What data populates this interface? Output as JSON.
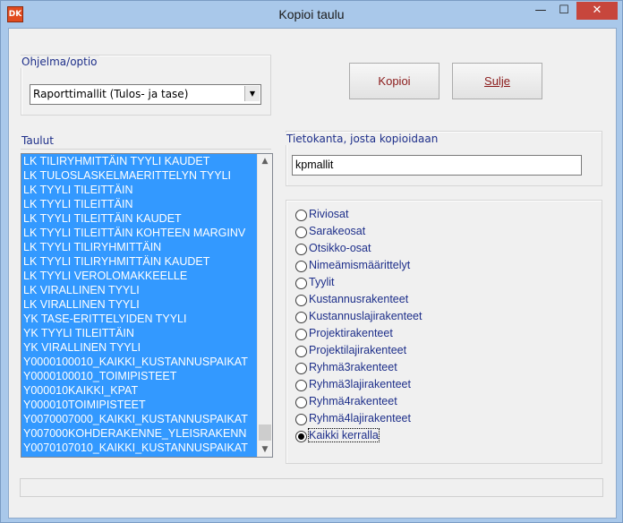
{
  "window": {
    "title": "Kopioi taulu",
    "icon_text": "DK",
    "minimize_glyph": "—",
    "maximize_glyph": "☐",
    "close_glyph": "✕"
  },
  "program_group": {
    "label": "Ohjelma/optio",
    "selected": "Raporttimallit (Tulos- ja tase)",
    "dropdown_glyph": "▼"
  },
  "buttons": {
    "copy": "Kopioi",
    "close": "Sulje"
  },
  "tables_group": {
    "label": "Taulut",
    "items": [
      "LK TILIRYHMITTÄIN TYYLI KAUDET",
      "LK TULOSLASKELMAERITTELYN TYYLI",
      "LK TYYLI TILEITTÄIN",
      "LK TYYLI TILEITTÄIN",
      "LK TYYLI TILEITTÄIN KAUDET",
      "LK TYYLI TILEITTÄIN KOHTEEN MARGINV",
      "LK TYYLI TILIRYHMITTÄIN",
      "LK TYYLI TILIRYHMITTÄIN KAUDET",
      "LK TYYLI VEROLOMAKKEELLE",
      "LK VIRALLINEN  TYYLI",
      "LK VIRALLINEN TYYLI",
      "YK TASE-ERITTELYIDEN TYYLI",
      "YK TYYLI TILEITTÄIN",
      "YK VIRALLINEN TYYLI",
      "Y0000100010_KAIKKI_KUSTANNUSPAIKAT",
      "Y0000100010_TOIMIPISTEET",
      "Y000010KAIKKI_KPAT",
      "Y000010TOIMIPISTEET",
      "Y0070007000_KAIKKI_KUSTANNUSPAIKAT",
      "Y007000KOHDERAKENNE_YLEISRAKENN",
      "Y0070107010_KAIKKI_KUSTANNUSPAIKAT"
    ],
    "scroll_up_glyph": "▲",
    "scroll_down_glyph": "▼"
  },
  "source_db": {
    "label": "Tietokanta, josta kopioidaan",
    "value": "kpmallit"
  },
  "options": {
    "items": [
      {
        "label": "Riviosat",
        "checked": false
      },
      {
        "label": "Sarakeosat",
        "checked": false
      },
      {
        "label": "Otsikko-osat",
        "checked": false
      },
      {
        "label": "Nimeämismäärittelyt",
        "checked": false
      },
      {
        "label": "Tyylit",
        "checked": false
      },
      {
        "label": "Kustannusrakenteet",
        "checked": false
      },
      {
        "label": "Kustannuslajirakenteet",
        "checked": false
      },
      {
        "label": "Projektirakenteet",
        "checked": false
      },
      {
        "label": "Projektilajirakenteet",
        "checked": false
      },
      {
        "label": "Ryhmä3rakenteet",
        "checked": false
      },
      {
        "label": "Ryhmä3lajirakenteet",
        "checked": false
      },
      {
        "label": "Ryhmä4rakenteet",
        "checked": false
      },
      {
        "label": "Ryhmä4lajirakenteet",
        "checked": false
      },
      {
        "label": "Kaikki kerralla",
        "checked": true
      }
    ]
  },
  "status": {
    "text": ""
  }
}
